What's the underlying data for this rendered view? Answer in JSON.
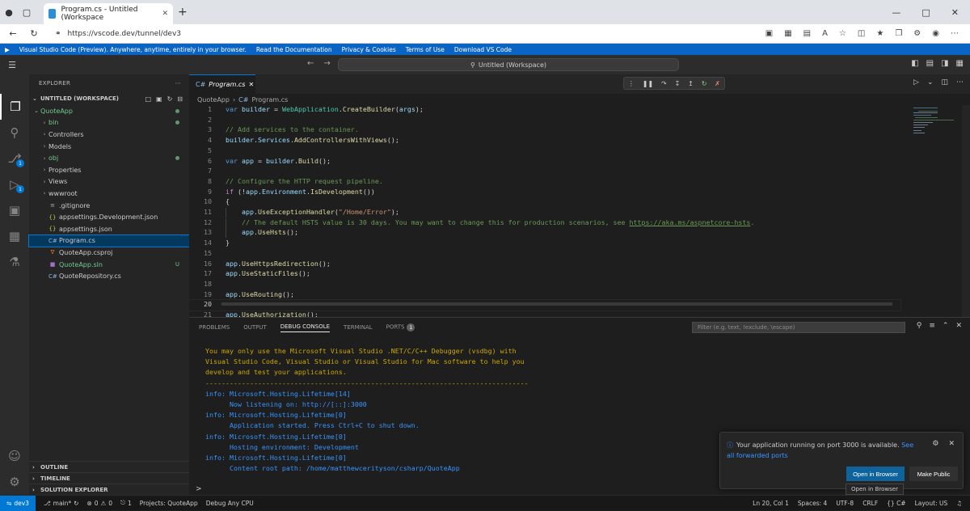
{
  "browser": {
    "tab_title": "Program.cs - Untitled (Workspace",
    "url": "https://vscode.dev/tunnel/dev3"
  },
  "banner": {
    "items": [
      "Visual Studio Code (Preview). Anywhere, anytime, entirely in your browser.",
      "Read the Documentation",
      "Privacy & Cookies",
      "Terms of Use",
      "Download VS Code"
    ]
  },
  "titlebar": {
    "command_center": "Untitled (Workspace)"
  },
  "activity_badges": {
    "source_control": "1",
    "run_debug": "1"
  },
  "sidebar": {
    "header": "EXPLORER",
    "workspace": "UNTITLED (WORKSPACE)",
    "tree": [
      {
        "label": "QuoteApp",
        "kind": "root",
        "indent": 0
      },
      {
        "label": "bin",
        "kind": "folder",
        "indent": 1
      },
      {
        "label": "Controllers",
        "kind": "folder",
        "indent": 1
      },
      {
        "label": "Models",
        "kind": "folder",
        "indent": 1
      },
      {
        "label": "obj",
        "kind": "folder",
        "indent": 1
      },
      {
        "label": "Properties",
        "kind": "folder",
        "indent": 1
      },
      {
        "label": "Views",
        "kind": "folder",
        "indent": 1
      },
      {
        "label": "wwwroot",
        "kind": "folder",
        "indent": 1
      },
      {
        "label": ".gitignore",
        "kind": "file",
        "indent": 1
      },
      {
        "label": "appsettings.Development.json",
        "kind": "json",
        "indent": 1
      },
      {
        "label": "appsettings.json",
        "kind": "json",
        "indent": 1
      },
      {
        "label": "Program.cs",
        "kind": "cs",
        "indent": 1
      },
      {
        "label": "QuoteApp.csproj",
        "kind": "xml",
        "indent": 1
      },
      {
        "label": "QuoteApp.sln",
        "kind": "sln",
        "indent": 1
      },
      {
        "label": "QuoteRepository.cs",
        "kind": "cs",
        "indent": 1
      }
    ],
    "sln_tag": "U",
    "sections": [
      "OUTLINE",
      "TIMELINE",
      "SOLUTION EXPLORER"
    ]
  },
  "editor": {
    "tab_label": "Program.cs",
    "breadcrumb": [
      "QuoteApp",
      "Program.cs"
    ]
  },
  "panel": {
    "tabs": [
      "PROBLEMS",
      "OUTPUT",
      "DEBUG CONSOLE",
      "TERMINAL",
      "PORTS"
    ],
    "ports_badge": "1",
    "filter_placeholder": "Filter (e.g. text, !exclude, \\escape)",
    "console_lines": [
      {
        "text": "You may only use the Microsoft Visual Studio .NET/C/C++ Debugger (vsdbg) with",
        "style": "warn"
      },
      {
        "text": "Visual Studio Code, Visual Studio or Visual Studio for Mac software to help you",
        "style": "warn"
      },
      {
        "text": "develop and test your applications.",
        "style": "warn"
      },
      {
        "text": "--------------------------------------------------------------------------------",
        "style": "warn"
      },
      {
        "text": "info: Microsoft.Hosting.Lifetime[14]",
        "style": "info"
      },
      {
        "text": "      Now listening on: http://[::]:3000",
        "style": "info"
      },
      {
        "text": "info: Microsoft.Hosting.Lifetime[0]",
        "style": "info"
      },
      {
        "text": "      Application started. Press Ctrl+C to shut down.",
        "style": "info"
      },
      {
        "text": "info: Microsoft.Hosting.Lifetime[0]",
        "style": "info"
      },
      {
        "text": "      Hosting environment: Development",
        "style": "info"
      },
      {
        "text": "info: Microsoft.Hosting.Lifetime[0]",
        "style": "info"
      },
      {
        "text": "      Content root path: /home/matthewcerityson/csharp/QuoteApp",
        "style": "info"
      }
    ],
    "prompt": ">"
  },
  "notification": {
    "message": "Your application running on port 3000 is available.",
    "link": "See all forwarded ports",
    "open_button": "Open in Browser",
    "public_button": "Make Public",
    "tooltip": "Open in Browser"
  },
  "statusbar": {
    "remote": "dev3",
    "branch": "main*",
    "errors": "0",
    "warnings": "0",
    "ports": "1",
    "project": "Projects: QuoteApp",
    "config": "Debug Any CPU",
    "right": [
      "Ln 20, Col 1",
      "Spaces: 4",
      "UTF-8",
      "CRLF",
      "{} C#",
      "Layout: US"
    ]
  },
  "colors": {
    "accent": "#0078d4",
    "banner": "#0a64c4",
    "warn": "#cca700",
    "info": "#3794ff"
  }
}
